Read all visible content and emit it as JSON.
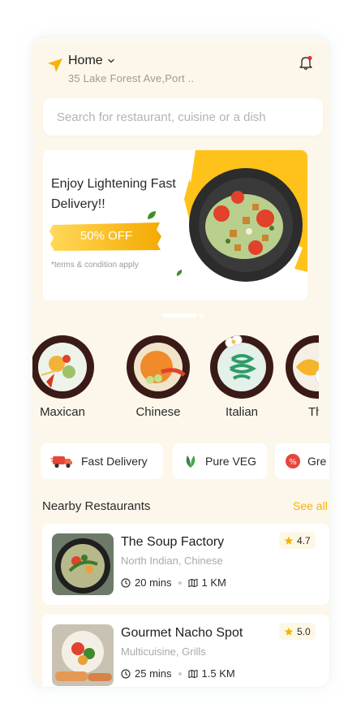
{
  "header": {
    "location_title": "Home",
    "address": "35 Lake Forest Ave,Port ..",
    "icons": [
      "location-arrow-icon",
      "chevron-down-icon",
      "notification-bell-icon"
    ]
  },
  "search": {
    "placeholder": "Search for restaurant, cuisine or a dish"
  },
  "banner": {
    "title": "Enjoy Lightening Fast Delivery!!",
    "offer": "50% OFF",
    "terms": "*terms & condition apply"
  },
  "categories": [
    {
      "label": "Maxican"
    },
    {
      "label": "Chinese"
    },
    {
      "label": "Italian"
    },
    {
      "label": "Th"
    }
  ],
  "filters": [
    {
      "label": "Fast Delivery",
      "icon": "delivery-truck-icon"
    },
    {
      "label": "Pure VEG",
      "icon": "veg-leaf-icon"
    },
    {
      "label": "Gre",
      "icon": "discount-badge-icon"
    }
  ],
  "nearby": {
    "title": "Nearby Restaurants",
    "see_all": "See all",
    "restaurants": [
      {
        "name": "The Soup Factory",
        "cuisine": "North Indian, Chinese",
        "time": "20 mins",
        "distance": "1 KM",
        "rating": "4.7"
      },
      {
        "name": "Gourmet Nacho Spot",
        "cuisine": "Multicuisine, Grills",
        "time": "25 mins",
        "distance": "1.5 KM",
        "rating": "5.0"
      }
    ]
  },
  "colors": {
    "accent": "#f5b30a",
    "background": "#fcf7ea",
    "notification_dot": "#e5322b"
  }
}
